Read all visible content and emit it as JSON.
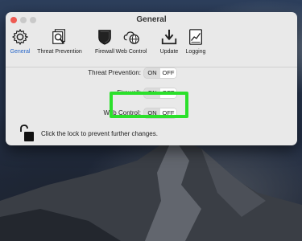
{
  "window": {
    "title": "General"
  },
  "tabs": [
    {
      "label": "General",
      "icon": "gear-icon",
      "active": true
    },
    {
      "label": "Threat Prevention",
      "icon": "magnifier-document-icon"
    },
    {
      "label": "Firewall",
      "icon": "shield-icon"
    },
    {
      "label": "Web Control",
      "icon": "globe-cloud-icon"
    },
    {
      "label": "Update",
      "icon": "download-tray-icon"
    },
    {
      "label": "Logging",
      "icon": "log-chart-icon"
    }
  ],
  "settings": {
    "threat_prevention": {
      "label": "Threat Prevention:",
      "on": "ON",
      "off": "OFF"
    },
    "firewall": {
      "label": "Firewall:",
      "on": "ON",
      "off": "OFF"
    },
    "web_control": {
      "label": "Web Control:",
      "on": "ON",
      "off": "OFF"
    }
  },
  "lock": {
    "text": "Click the lock to prevent further changes."
  },
  "colors": {
    "highlight": "#2be02b",
    "accent": "#2867c9",
    "close": "#ee5a52"
  }
}
